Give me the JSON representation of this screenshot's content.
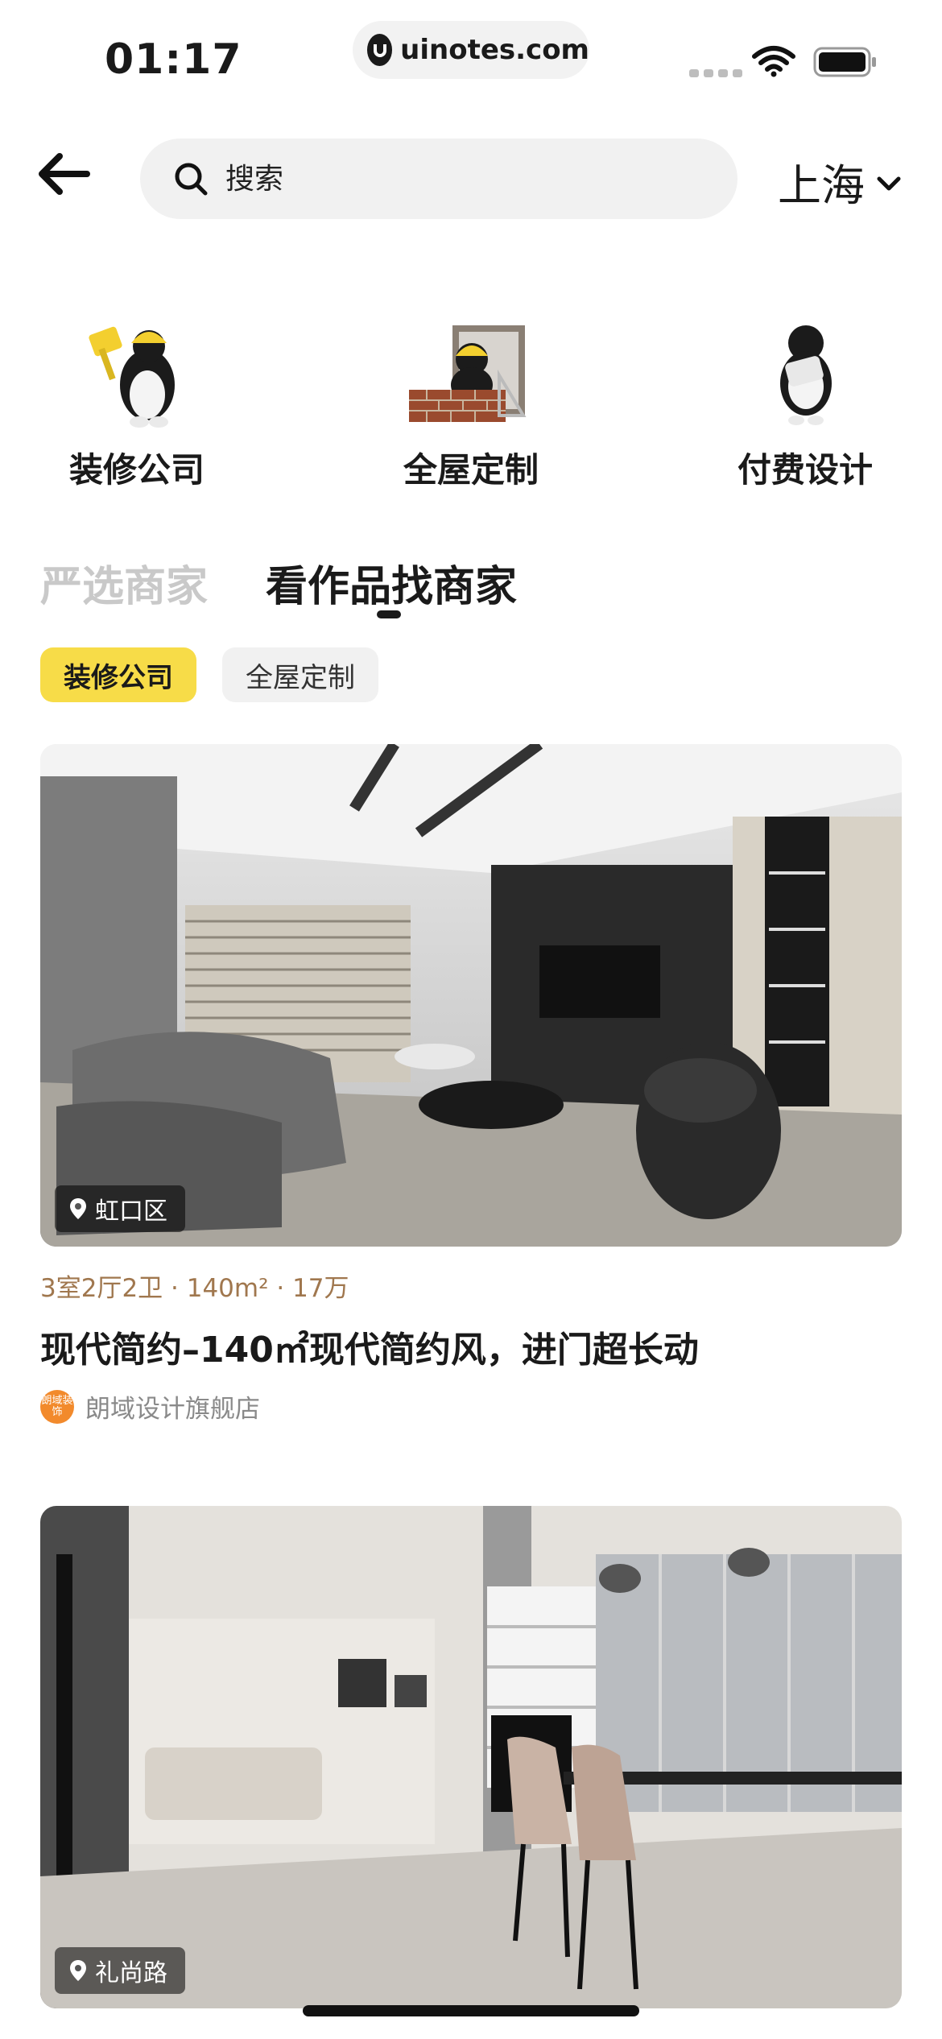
{
  "status_bar": {
    "time": "01:17",
    "url": "uinotes.com",
    "icons": [
      "signal-icon",
      "wifi-icon",
      "battery-icon"
    ]
  },
  "header": {
    "back_icon": "arrow-left-icon",
    "search_placeholder": "搜索",
    "city": "上海"
  },
  "categories": [
    {
      "label": "装修公司",
      "icon": "worker-mascot-icon"
    },
    {
      "label": "全屋定制",
      "icon": "brick-wall-mascot-icon"
    },
    {
      "label": "付费设计",
      "icon": "designer-mascot-icon"
    }
  ],
  "tabs": [
    {
      "label": "严选商家",
      "active": false
    },
    {
      "label": "看作品找商家",
      "active": true
    }
  ],
  "chips": [
    {
      "label": "装修公司",
      "active": true
    },
    {
      "label": "全屋定制",
      "active": false
    }
  ],
  "cards": [
    {
      "location": "虹口区",
      "meta": "3室2厅2卫 · 140m² · 17万",
      "title": "现代简约–140㎡现代简约风，进门超长动",
      "shop": "朗域设计旗舰店",
      "shop_avatar": "朗域装饰"
    },
    {
      "location": "礼尚路"
    }
  ],
  "colors": {
    "accent_yellow": "#f7dc48",
    "meta_brown": "#a0774e",
    "inactive_tab": "#c9c9c9"
  }
}
